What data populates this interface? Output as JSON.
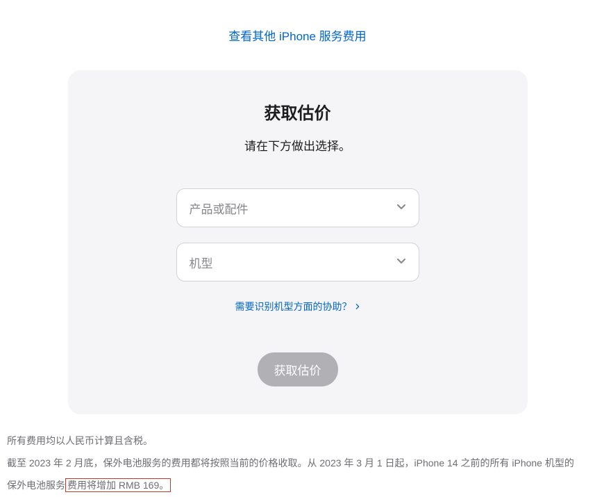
{
  "topLink": {
    "label": "查看其他 iPhone 服务费用"
  },
  "card": {
    "title": "获取估价",
    "subtitle": "请在下方做出选择。",
    "productSelect": {
      "placeholder": "产品或配件"
    },
    "modelSelect": {
      "placeholder": "机型"
    },
    "helpLink": {
      "label": "需要识别机型方面的协助？"
    },
    "submitButton": {
      "label": "获取估价"
    }
  },
  "footer": {
    "note1": "所有费用均以人民币计算且含税。",
    "note2_part1": "截至 2023 年 2 月底，保外电池服务的费用都将按照当前的价格收取。从 2023 年 3 月 1 日起，iPhone 14 之前的所有 iPhone 机型的保外电池服务",
    "note2_part2": "费用将增加 RMB 169。"
  }
}
